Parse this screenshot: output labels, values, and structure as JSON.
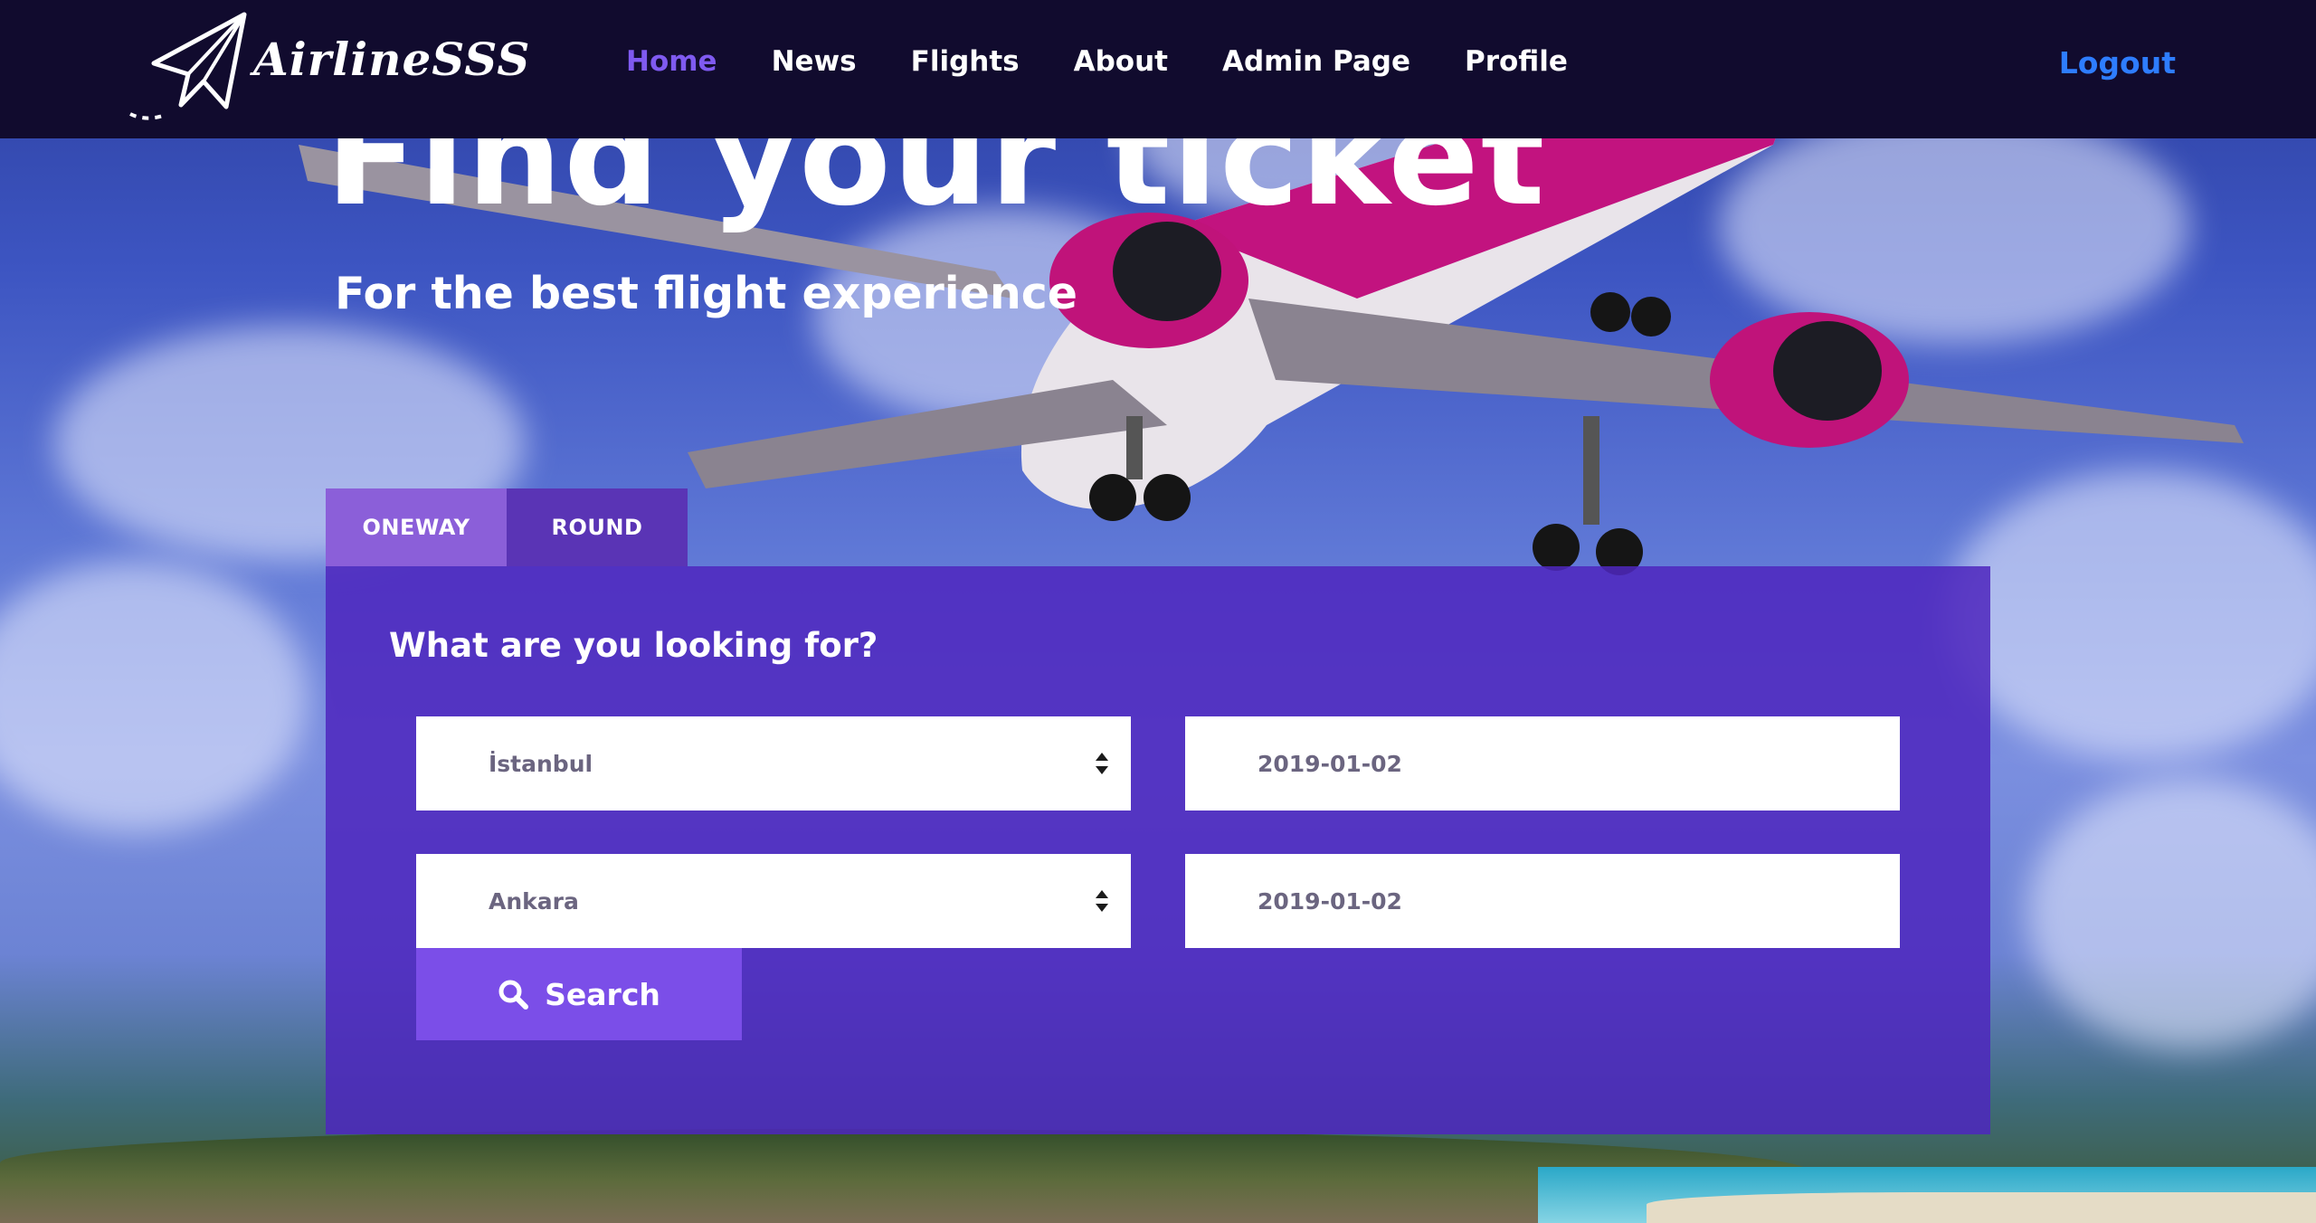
{
  "brand": {
    "name": "AirlineSSS",
    "logo_icon": "paper-plane-icon"
  },
  "nav": {
    "items": [
      {
        "label": "Home",
        "active": true
      },
      {
        "label": "News",
        "active": false
      },
      {
        "label": "Flights",
        "active": false
      },
      {
        "label": "About",
        "active": false
      },
      {
        "label": "Admin Page",
        "active": false
      },
      {
        "label": "Profile",
        "active": false
      }
    ],
    "logout": "Logout"
  },
  "hero": {
    "title": "Find your ticket",
    "subtitle": "For the best flight experience"
  },
  "search": {
    "tabs": [
      "ONEWAY",
      "ROUND"
    ],
    "active_tab": "ONEWAY",
    "heading": "What are you looking for?",
    "from": "İstanbul",
    "to": "Ankara",
    "depart_date": "2019-01-02",
    "return_date": "2019-01-02",
    "button_label": "Search",
    "button_icon": "search-icon"
  },
  "colors": {
    "navbar": "#110b2e",
    "accent": "#7f5af0",
    "logout": "#2e7dff",
    "tab_active": "#8b5fd9",
    "tab_inactive": "#5a34b5",
    "panel": "#4e26be",
    "button": "#7b4ee8"
  }
}
